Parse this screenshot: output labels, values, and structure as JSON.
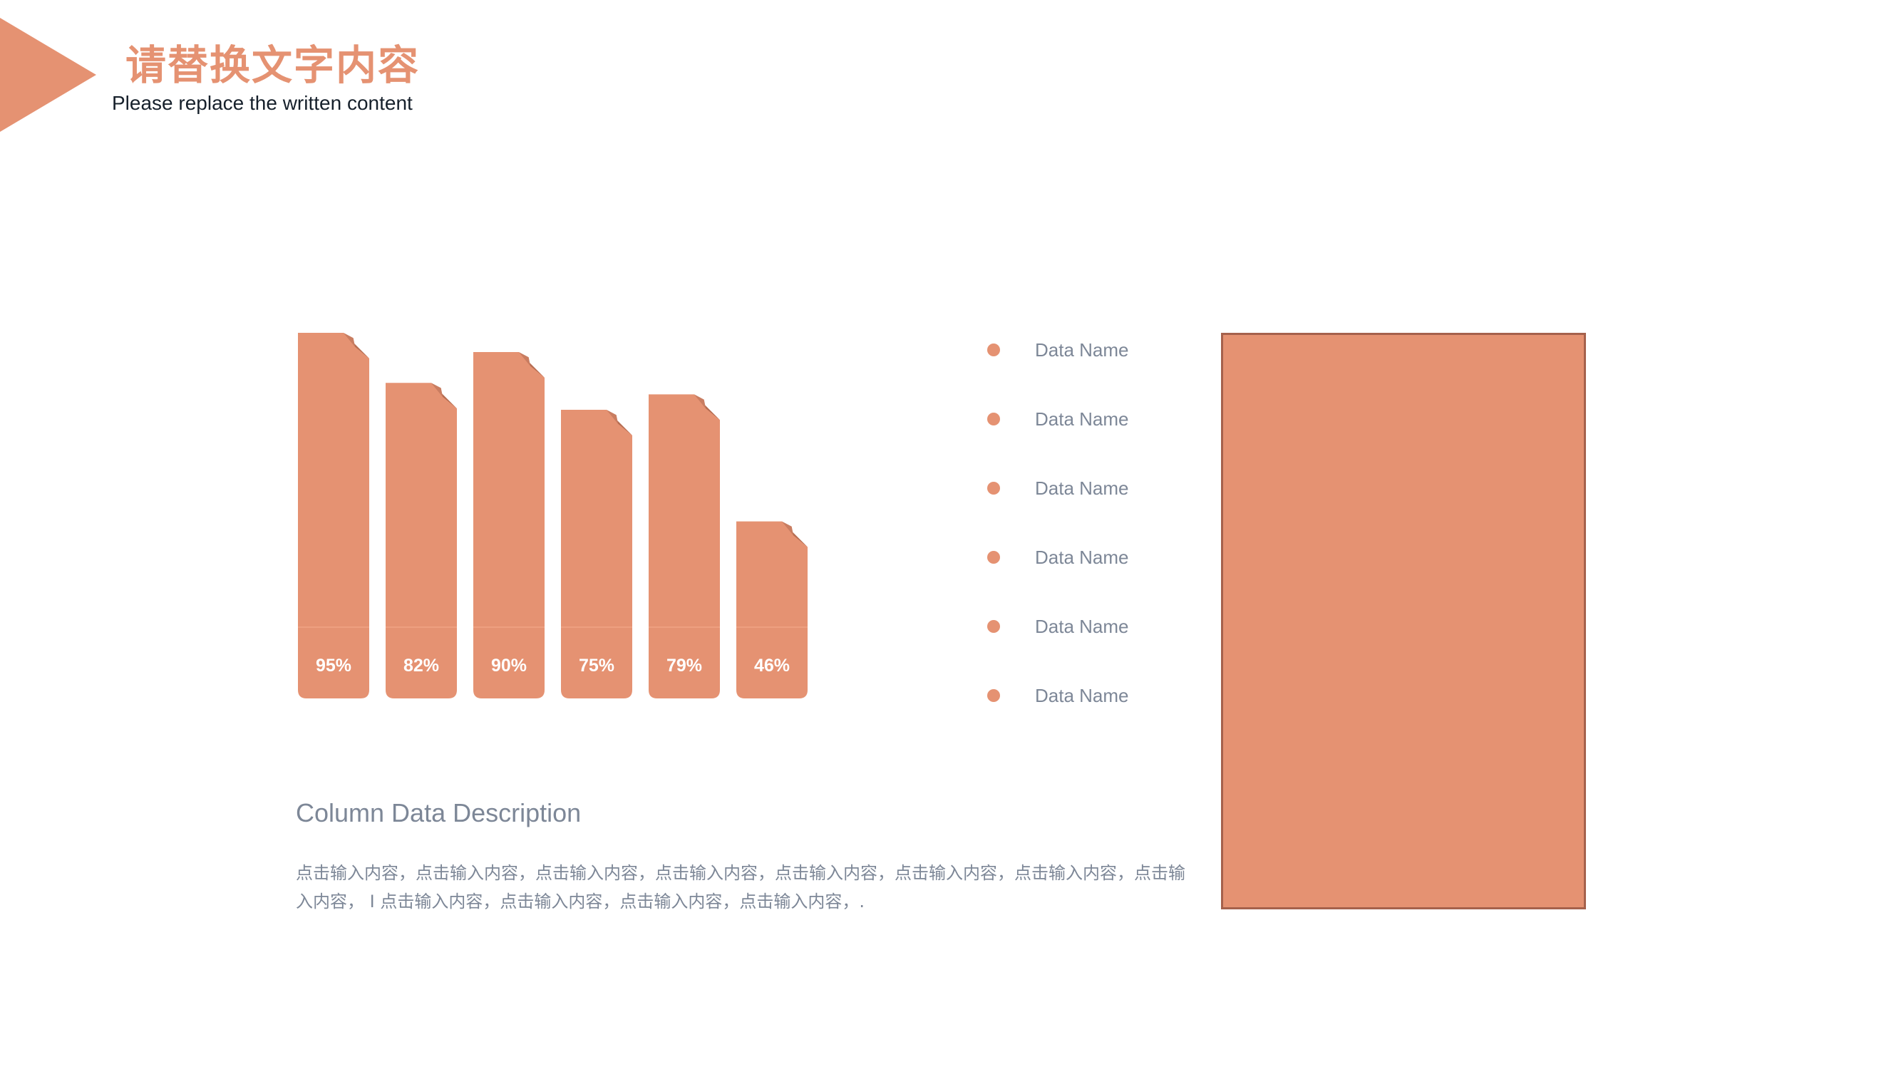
{
  "header": {
    "title": "请替换文字内容",
    "subtitle": "Please replace the written content"
  },
  "colors": {
    "accent": "#e59272",
    "accent_dark": "#a5614c",
    "fold": "#b56d52",
    "text_muted": "#7d8797",
    "text_dark": "#16202b"
  },
  "chart_data": {
    "type": "bar",
    "categories": [
      "",
      "",
      "",
      "",
      "",
      ""
    ],
    "values": [
      95,
      82,
      90,
      75,
      79,
      46
    ],
    "labels": [
      "95%",
      "82%",
      "90%",
      "75%",
      "79%",
      "46%"
    ],
    "ylim": [
      0,
      100
    ],
    "grid": false,
    "legend": "none"
  },
  "legend": {
    "items": [
      {
        "label": "Data Name"
      },
      {
        "label": "Data Name"
      },
      {
        "label": "Data Name"
      },
      {
        "label": "Data Name"
      },
      {
        "label": "Data Name"
      },
      {
        "label": "Data Name"
      }
    ]
  },
  "description": {
    "title": "Column Data Description",
    "body": "点击输入内容，点击输入内容，点击输入内容，点击输入内容，点击输入内容，点击输入内容，点击输入内容，点击输入内容， I 点击输入内容，点击输入内容，点击输入内容，点击输入内容，."
  }
}
